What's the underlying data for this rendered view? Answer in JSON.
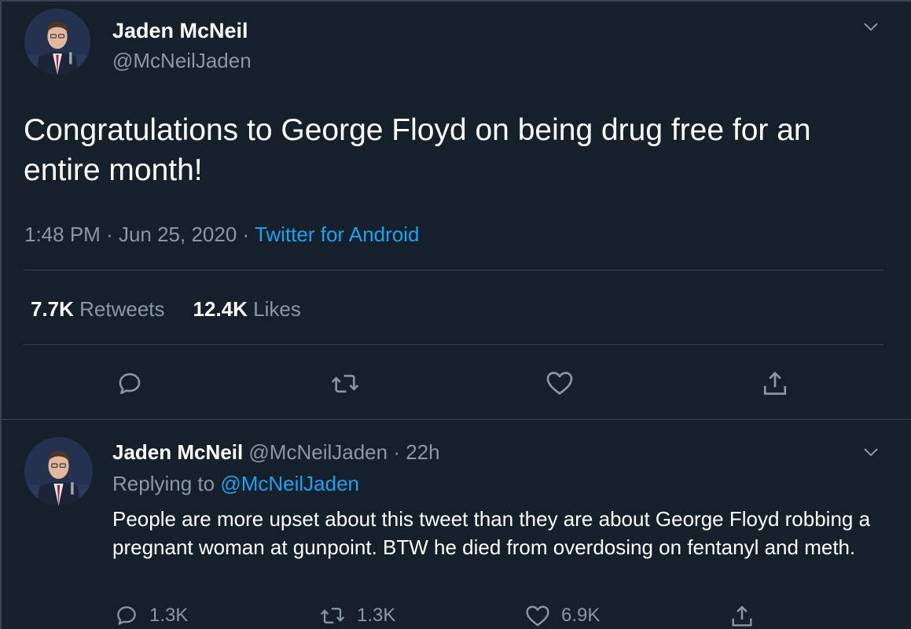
{
  "tweet": {
    "author_name": "Jaden McNeil",
    "author_handle": "@McNeilJaden",
    "text": "Congratulations to George Floyd on being drug free for an entire month!",
    "time": "1:48 PM",
    "separator1": " · ",
    "date": "Jun 25, 2020",
    "separator2": " · ",
    "source": "Twitter for Android",
    "retweets_count": "7.7K",
    "retweets_label": " Retweets",
    "likes_count": "12.4K",
    "likes_label": " Likes"
  },
  "reply": {
    "author_name": "Jaden McNeil",
    "author_handle": "@McNeilJaden",
    "separator": " · ",
    "time": "22h",
    "replying_prefix": "Replying to ",
    "replying_to": "@McNeilJaden",
    "text": "People are more upset about this tweet than they are about George Floyd robbing a pregnant woman at gunpoint. BTW he died from overdosing on fentanyl and meth.",
    "replies_count": "1.3K",
    "retweets_count": "1.3K",
    "likes_count": "6.9K"
  },
  "icons": {
    "reply": "speech-bubble-icon",
    "retweet": "retweet-arrows-icon",
    "like": "heart-icon",
    "share": "share-upload-icon",
    "menu": "chevron-down-icon"
  },
  "colors": {
    "background": "#15202b",
    "text": "#ffffff",
    "secondary": "#8899a6",
    "accent": "#1da1f2",
    "divider": "#38444d"
  }
}
